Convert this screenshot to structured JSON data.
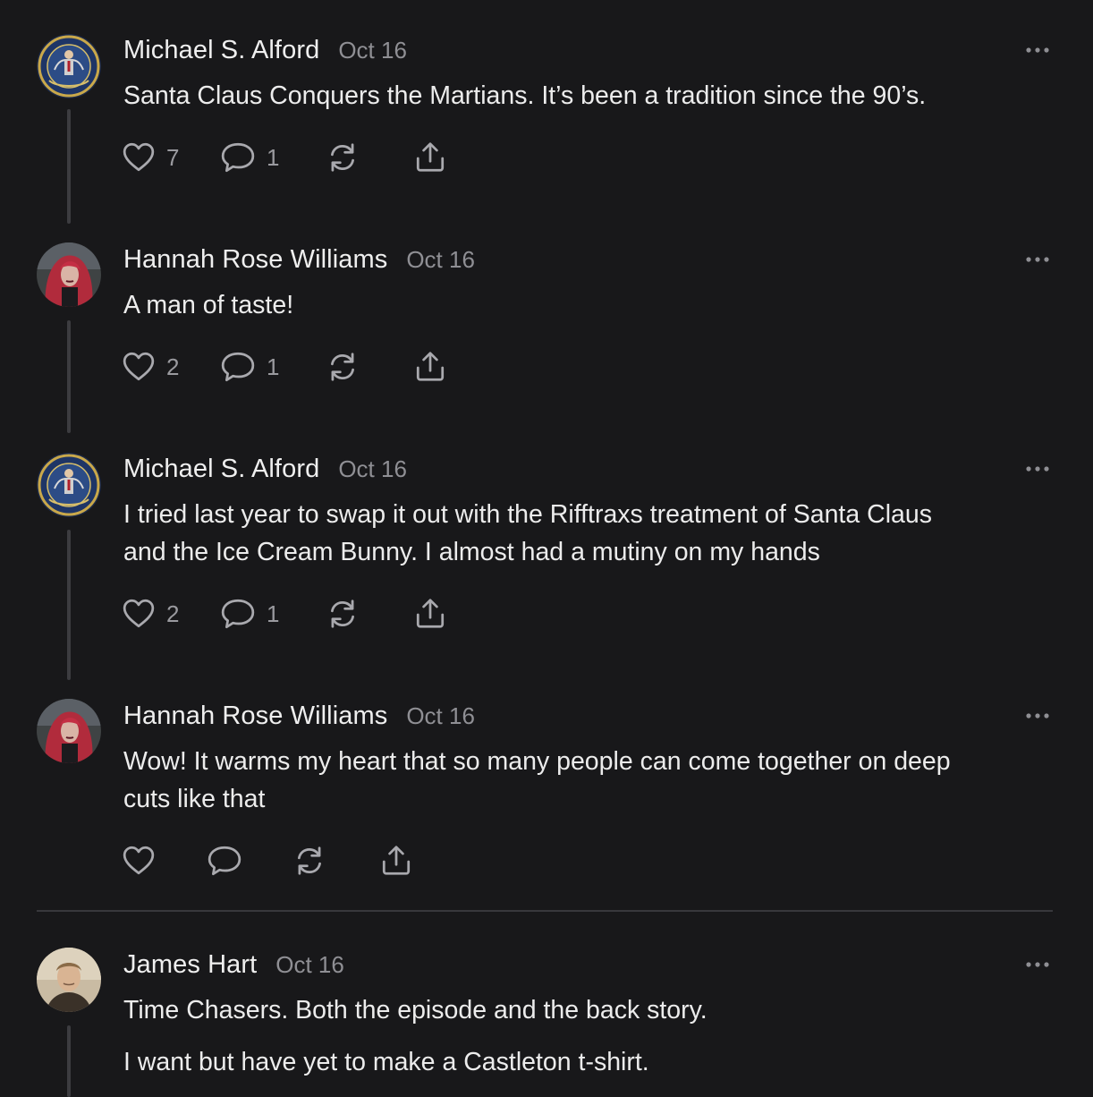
{
  "comments": [
    {
      "author": "Michael S. Alford",
      "date": "Oct 16",
      "lines": [
        "Santa Claus Conquers the Martians. It’s been a tradition since the 90’s."
      ],
      "likes": "7",
      "replies": "1",
      "avatar": "seal-emblem-avatar"
    },
    {
      "author": "Hannah Rose Williams",
      "date": "Oct 16",
      "lines": [
        "A man of taste!"
      ],
      "likes": "2",
      "replies": "1",
      "avatar": "red-hair-portrait-avatar"
    },
    {
      "author": "Michael S. Alford",
      "date": "Oct 16",
      "lines": [
        "I tried last year to swap it out with the Rifftraxs treatment of Santa Claus",
        "and the Ice Cream Bunny. I almost had a mutiny on my hands"
      ],
      "likes": "2",
      "replies": "1",
      "avatar": "seal-emblem-avatar"
    },
    {
      "author": "Hannah Rose Williams",
      "date": "Oct 16",
      "lines": [
        "Wow! It warms my heart that so many people can come together on deep",
        "cuts like that"
      ],
      "likes": "",
      "replies": "",
      "avatar": "red-hair-portrait-avatar"
    },
    {
      "author": "James Hart",
      "date": "Oct 16",
      "lines": [
        "Time Chasers. Both the episode and the back story.",
        "I want but have yet to make a Castleton t-shirt."
      ],
      "likes": "",
      "replies": "",
      "avatar": "man-portrait-avatar"
    }
  ],
  "icons": {
    "like": "heart-icon",
    "reply": "comment-bubble-icon",
    "restack": "restack-arrows-icon",
    "share": "share-upload-icon",
    "menu": "more-dots-icon"
  },
  "colors": {
    "background": "#18181a",
    "text": "#ececec",
    "muted": "#8f8f94",
    "icon": "#a9a9ae",
    "thread_line": "#3c3c40"
  }
}
